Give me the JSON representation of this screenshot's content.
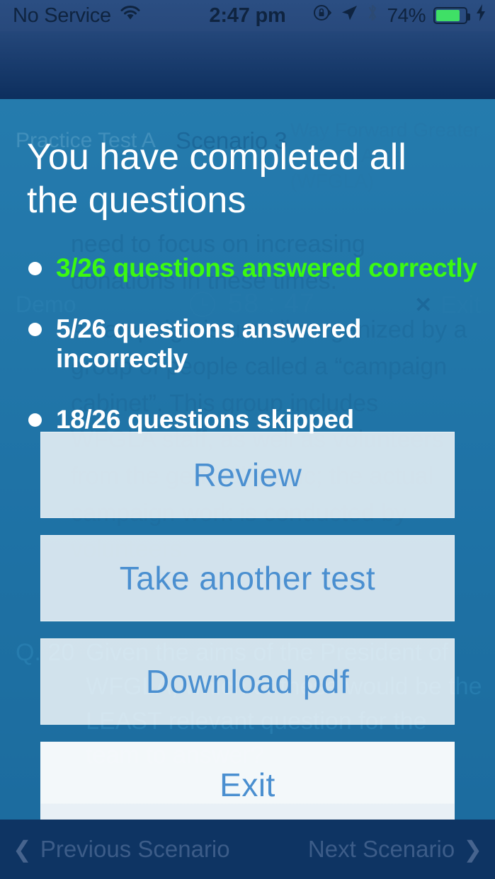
{
  "status_bar": {
    "carrier": "No Service",
    "wifi_icon": "wifi-icon",
    "time": "2:47 pm",
    "rotation_lock_icon": "rotation-lock-icon",
    "location_icon": "location-arrow-icon",
    "bluetooth_icon": "bluetooth-icon",
    "battery_percent": "74%",
    "battery_level": 74,
    "charging_icon": "lightning-bolt-icon"
  },
  "test_page": {
    "test_name": "Practice Test A",
    "scenario": "Scenario 3",
    "organisation": "Way Forward Greater London Area (WFGLA)",
    "plan_label": "Demo",
    "clock_icon": "clock-icon",
    "timer": "58 : 47",
    "exit_label": "Exit",
    "exit_icon": "close-x-icon",
    "passage": [
      "need to focus on increasing donations in these times.",
      "A campaign is usually organized by a group of people called a “campaign cabinet”. This group includes WFGLA staff, as well as volunteers from the general public; the actual campaign work is conducted by volunteers."
    ],
    "question_number": "Q. 20",
    "question_text": "Given the aims of the President of WFGLA, which of these would be the LEAST relevant question for the team to answer?"
  },
  "bottom_nav": {
    "previous_label": "Previous Scenario",
    "previous_icon": "chevron-left-icon",
    "next_label": "Next Scenario",
    "next_icon": "chevron-right-icon"
  },
  "overlay": {
    "title": "You have completed all the questions",
    "results": [
      {
        "text": "3/26 questions answered correctly",
        "color": "#3bfa11"
      },
      {
        "text": "5/26 questions answered incorrectly",
        "color": "#ffffff"
      },
      {
        "text": "18/26 questions skipped",
        "color": "#ffffff"
      }
    ],
    "buttons": [
      {
        "label": "Review"
      },
      {
        "label": "Take another test"
      },
      {
        "label": "Download pdf"
      },
      {
        "label": "Exit"
      }
    ]
  },
  "colors": {
    "navy": "#0d2f5e",
    "blue": "#1f71a5",
    "accent_green": "#3bfa11",
    "button_text": "#4a8fd0",
    "battery_green": "#3fe066"
  }
}
